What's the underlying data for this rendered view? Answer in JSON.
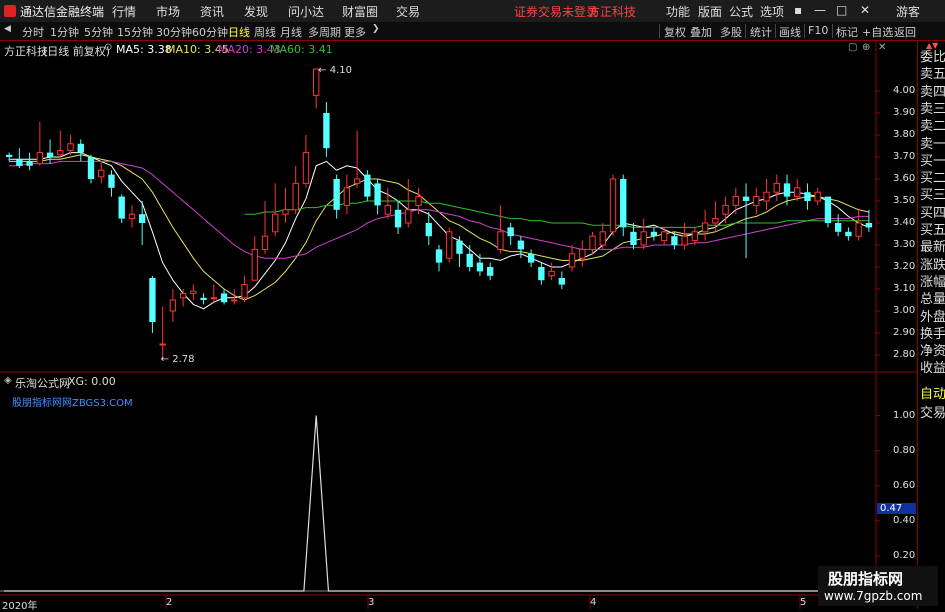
{
  "app": {
    "title": "通达信金融终端",
    "window_controls": [
      "▪",
      "—",
      "□",
      "✕"
    ]
  },
  "menu": {
    "items": [
      "行情",
      "市场",
      "资讯",
      "发现",
      "问小达",
      "财富圈",
      "交易"
    ],
    "login_notice": "证券交易未登录",
    "broker": "方正科技",
    "right_items": [
      "功能",
      "版面",
      "公式",
      "选项"
    ],
    "guest": "游客"
  },
  "toolbar": {
    "periods": [
      "分时",
      "1分钟",
      "5分钟",
      "15分钟",
      "30分钟",
      "60分钟",
      "日线",
      "周线",
      "月线",
      "多周期",
      "更多"
    ],
    "active": "日线",
    "right": [
      "复权",
      "叠加",
      "多股",
      "统计",
      "画线",
      "F10",
      "标记",
      "+自选",
      "返回"
    ]
  },
  "main": {
    "stock": "方正科技",
    "mode": "(日线 前复权)",
    "ma": [
      {
        "label": "MA5: 3.38",
        "color": "#ffffff"
      },
      {
        "label": "MA10: 3.45",
        "color": "#e8e060"
      },
      {
        "label": "MA20: 3.43",
        "color": "#d040d0"
      },
      {
        "label": "MA60: 3.41",
        "color": "#30c030"
      }
    ],
    "high_label": "4.10",
    "low_label": "2.78",
    "y_ticks": [
      "4.00",
      "3.90",
      "3.80",
      "3.70",
      "3.60",
      "3.50",
      "3.40",
      "3.30",
      "3.20",
      "3.10",
      "3.00",
      "2.90",
      "2.80"
    ]
  },
  "indicator": {
    "name": "乐淘公式网",
    "value": "XG: 0.00",
    "site": "股朋指标网网ZBGS3.COM",
    "y_ticks": [
      "1.00",
      "0.80",
      "0.60",
      "0.47",
      "0.40",
      "0.20"
    ]
  },
  "xaxis": {
    "labels": [
      "2020年",
      "2",
      "3",
      "4",
      "5"
    ]
  },
  "side": {
    "items": [
      "委比",
      "卖五",
      "卖四",
      "卖三",
      "卖二",
      "卖一",
      "买一",
      "买二",
      "买三",
      "买四",
      "买五",
      "最新",
      "涨跌",
      "涨幅",
      "总量",
      "外盘",
      "换手",
      "净资",
      "收益"
    ],
    "bottom": [
      "自动",
      "交易"
    ]
  },
  "watermark": {
    "line1": "股朋指标网",
    "line2": "www.7gpzb.com"
  },
  "chart_data": {
    "type": "candlestick",
    "ylim": [
      2.75,
      4.15
    ],
    "candles": [
      [
        3.71,
        3.7,
        3.72,
        3.68
      ],
      [
        3.69,
        3.66,
        3.74,
        3.65
      ],
      [
        3.68,
        3.66,
        3.72,
        3.64
      ],
      [
        3.67,
        3.72,
        3.86,
        3.66
      ],
      [
        3.72,
        3.7,
        3.78,
        3.67
      ],
      [
        3.71,
        3.73,
        3.82,
        3.7
      ],
      [
        3.73,
        3.76,
        3.8,
        3.71
      ],
      [
        3.76,
        3.72,
        3.78,
        3.68
      ],
      [
        3.7,
        3.6,
        3.71,
        3.58
      ],
      [
        3.61,
        3.64,
        3.68,
        3.58
      ],
      [
        3.62,
        3.56,
        3.64,
        3.52
      ],
      [
        3.52,
        3.42,
        3.53,
        3.4
      ],
      [
        3.42,
        3.44,
        3.48,
        3.38
      ],
      [
        3.44,
        3.4,
        3.5,
        3.3
      ],
      [
        3.15,
        2.95,
        3.16,
        2.9
      ],
      [
        2.85,
        2.85,
        3.02,
        2.78
      ],
      [
        3.0,
        3.05,
        3.1,
        2.95
      ],
      [
        3.06,
        3.08,
        3.1,
        3.02
      ],
      [
        3.08,
        3.09,
        3.12,
        3.05
      ],
      [
        3.06,
        3.05,
        3.08,
        3.03
      ],
      [
        3.06,
        3.06,
        3.12,
        3.04
      ],
      [
        3.08,
        3.04,
        3.1,
        3.03
      ],
      [
        3.05,
        3.05,
        3.1,
        3.03
      ],
      [
        3.06,
        3.12,
        3.16,
        3.04
      ],
      [
        3.14,
        3.28,
        3.34,
        3.14
      ],
      [
        3.28,
        3.34,
        3.5,
        3.26
      ],
      [
        3.36,
        3.44,
        3.58,
        3.34
      ],
      [
        3.44,
        3.46,
        3.56,
        3.4
      ],
      [
        3.46,
        3.58,
        3.66,
        3.44
      ],
      [
        3.58,
        3.72,
        3.8,
        3.56
      ],
      [
        3.98,
        4.1,
        4.1,
        3.92
      ],
      [
        3.9,
        3.74,
        3.95,
        3.7
      ],
      [
        3.6,
        3.46,
        3.62,
        3.42
      ],
      [
        3.48,
        3.56,
        3.62,
        3.44
      ],
      [
        3.58,
        3.6,
        3.82,
        3.56
      ],
      [
        3.62,
        3.52,
        3.64,
        3.5
      ],
      [
        3.58,
        3.48,
        3.6,
        3.44
      ],
      [
        3.44,
        3.48,
        3.56,
        3.42
      ],
      [
        3.46,
        3.38,
        3.5,
        3.35
      ],
      [
        3.4,
        3.46,
        3.6,
        3.38
      ],
      [
        3.48,
        3.52,
        3.56,
        3.44
      ],
      [
        3.4,
        3.34,
        3.45,
        3.3
      ],
      [
        3.28,
        3.22,
        3.3,
        3.18
      ],
      [
        3.24,
        3.36,
        3.38,
        3.22
      ],
      [
        3.32,
        3.26,
        3.34,
        3.2
      ],
      [
        3.26,
        3.2,
        3.3,
        3.18
      ],
      [
        3.22,
        3.18,
        3.26,
        3.16
      ],
      [
        3.2,
        3.16,
        3.22,
        3.14
      ],
      [
        3.28,
        3.36,
        3.48,
        3.26
      ],
      [
        3.38,
        3.34,
        3.4,
        3.3
      ],
      [
        3.32,
        3.28,
        3.34,
        3.24
      ],
      [
        3.26,
        3.22,
        3.28,
        3.2
      ],
      [
        3.2,
        3.14,
        3.22,
        3.12
      ],
      [
        3.16,
        3.18,
        3.22,
        3.14
      ],
      [
        3.15,
        3.12,
        3.18,
        3.1
      ],
      [
        3.2,
        3.26,
        3.3,
        3.18
      ],
      [
        3.24,
        3.28,
        3.32,
        3.2
      ],
      [
        3.28,
        3.34,
        3.36,
        3.26
      ],
      [
        3.3,
        3.36,
        3.4,
        3.28
      ],
      [
        3.36,
        3.6,
        3.62,
        3.34
      ],
      [
        3.6,
        3.38,
        3.62,
        3.34
      ],
      [
        3.36,
        3.3,
        3.4,
        3.28
      ],
      [
        3.3,
        3.36,
        3.42,
        3.28
      ],
      [
        3.36,
        3.34,
        3.38,
        3.32
      ],
      [
        3.32,
        3.36,
        3.38,
        3.3
      ],
      [
        3.34,
        3.3,
        3.36,
        3.28
      ],
      [
        3.3,
        3.34,
        3.4,
        3.28
      ],
      [
        3.32,
        3.36,
        3.38,
        3.3
      ],
      [
        3.36,
        3.4,
        3.46,
        3.32
      ],
      [
        3.4,
        3.42,
        3.5,
        3.36
      ],
      [
        3.44,
        3.48,
        3.52,
        3.4
      ],
      [
        3.48,
        3.52,
        3.56,
        3.44
      ],
      [
        3.52,
        3.5,
        3.58,
        3.24
      ],
      [
        3.48,
        3.52,
        3.56,
        3.44
      ],
      [
        3.5,
        3.54,
        3.6,
        3.46
      ],
      [
        3.54,
        3.58,
        3.62,
        3.5
      ],
      [
        3.58,
        3.52,
        3.62,
        3.48
      ],
      [
        3.52,
        3.56,
        3.6,
        3.5
      ],
      [
        3.54,
        3.5,
        3.58,
        3.46
      ],
      [
        3.5,
        3.54,
        3.56,
        3.48
      ],
      [
        3.52,
        3.4,
        3.52,
        3.38
      ],
      [
        3.4,
        3.36,
        3.44,
        3.34
      ],
      [
        3.36,
        3.34,
        3.38,
        3.32
      ],
      [
        3.34,
        3.4,
        3.46,
        3.32
      ],
      [
        3.4,
        3.38,
        3.46,
        3.36
      ]
    ],
    "ma": [
      {
        "name": "MA5",
        "color": "#ffffff",
        "values": [
          3.69,
          3.69,
          3.69,
          3.69,
          3.7,
          3.7,
          3.72,
          3.72,
          3.7,
          3.68,
          3.66,
          3.59,
          3.54,
          3.49,
          3.36,
          3.22,
          3.14,
          3.08,
          3.03,
          3.01,
          3.04,
          3.06,
          3.06,
          3.07,
          3.11,
          3.17,
          3.23,
          3.31,
          3.42,
          3.51,
          3.66,
          3.68,
          3.64,
          3.66,
          3.65,
          3.6,
          3.55,
          3.53,
          3.5,
          3.46,
          3.46,
          3.44,
          3.39,
          3.34,
          3.32,
          3.28,
          3.24,
          3.24,
          3.23,
          3.25,
          3.26,
          3.24,
          3.22,
          3.2,
          3.2,
          3.22,
          3.24,
          3.26,
          3.3,
          3.36,
          3.4,
          3.39,
          3.38,
          3.39,
          3.37,
          3.35,
          3.34,
          3.35,
          3.37,
          3.38,
          3.42,
          3.46,
          3.48,
          3.5,
          3.51,
          3.53,
          3.54,
          3.54,
          3.53,
          3.52,
          3.5,
          3.47,
          3.43,
          3.4,
          3.38
        ]
      },
      {
        "name": "MA10",
        "color": "#e8e060",
        "values": [
          3.68,
          3.68,
          3.68,
          3.68,
          3.69,
          3.69,
          3.7,
          3.71,
          3.7,
          3.69,
          3.68,
          3.66,
          3.63,
          3.6,
          3.54,
          3.46,
          3.38,
          3.31,
          3.24,
          3.18,
          3.14,
          3.1,
          3.07,
          3.05,
          3.07,
          3.1,
          3.13,
          3.18,
          3.24,
          3.31,
          3.41,
          3.48,
          3.52,
          3.56,
          3.58,
          3.6,
          3.6,
          3.59,
          3.58,
          3.55,
          3.53,
          3.49,
          3.45,
          3.41,
          3.39,
          3.36,
          3.33,
          3.31,
          3.28,
          3.27,
          3.27,
          3.26,
          3.25,
          3.24,
          3.23,
          3.23,
          3.23,
          3.24,
          3.25,
          3.28,
          3.31,
          3.32,
          3.33,
          3.34,
          3.35,
          3.36,
          3.35,
          3.35,
          3.35,
          3.36,
          3.38,
          3.4,
          3.42,
          3.43,
          3.45,
          3.48,
          3.5,
          3.51,
          3.52,
          3.52,
          3.51,
          3.5,
          3.48,
          3.46,
          3.45
        ]
      },
      {
        "name": "MA20",
        "color": "#d040d0",
        "values": [
          3.66,
          3.66,
          3.67,
          3.67,
          3.67,
          3.68,
          3.68,
          3.68,
          3.68,
          3.68,
          3.68,
          3.67,
          3.66,
          3.65,
          3.62,
          3.58,
          3.54,
          3.5,
          3.46,
          3.42,
          3.38,
          3.34,
          3.3,
          3.27,
          3.25,
          3.24,
          3.24,
          3.24,
          3.25,
          3.26,
          3.29,
          3.31,
          3.33,
          3.35,
          3.37,
          3.4,
          3.42,
          3.43,
          3.44,
          3.45,
          3.46,
          3.46,
          3.45,
          3.44,
          3.43,
          3.41,
          3.4,
          3.38,
          3.37,
          3.35,
          3.34,
          3.33,
          3.32,
          3.31,
          3.3,
          3.29,
          3.28,
          3.28,
          3.28,
          3.28,
          3.29,
          3.29,
          3.29,
          3.3,
          3.3,
          3.3,
          3.3,
          3.31,
          3.31,
          3.32,
          3.33,
          3.34,
          3.35,
          3.36,
          3.37,
          3.38,
          3.39,
          3.4,
          3.41,
          3.42,
          3.42,
          3.42,
          3.42,
          3.43,
          3.43
        ]
      },
      {
        "name": "MA60",
        "color": "#30c030",
        "start": 23,
        "values": [
          3.44,
          3.44,
          3.45,
          3.45,
          3.46,
          3.46,
          3.47,
          3.47,
          3.48,
          3.48,
          3.49,
          3.49,
          3.5,
          3.5,
          3.5,
          3.5,
          3.5,
          3.5,
          3.49,
          3.49,
          3.48,
          3.47,
          3.46,
          3.45,
          3.44,
          3.43,
          3.42,
          3.42,
          3.41,
          3.41,
          3.4,
          3.4,
          3.4,
          3.4,
          3.39,
          3.39,
          3.39,
          3.39,
          3.38,
          3.38,
          3.38,
          3.38,
          3.38,
          3.38,
          3.38,
          3.39,
          3.39,
          3.39,
          3.4,
          3.4,
          3.4,
          3.4,
          3.4,
          3.41,
          3.41,
          3.41,
          3.41,
          3.41,
          3.41,
          3.41,
          3.41,
          3.41
        ]
      }
    ],
    "signal": {
      "ylim": [
        0,
        1.1
      ],
      "peak_index": 30,
      "peak_value": 1.0
    }
  }
}
